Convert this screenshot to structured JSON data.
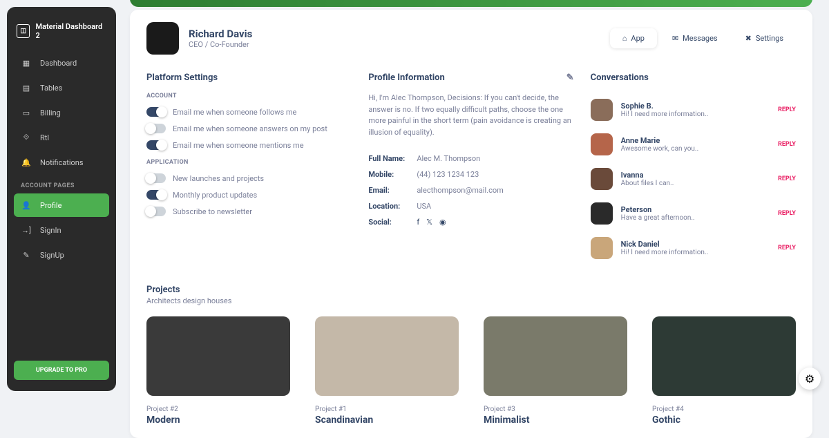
{
  "brand": "Material Dashboard 2",
  "nav": {
    "items": [
      "Dashboard",
      "Tables",
      "Billing",
      "Rtl",
      "Notifications"
    ],
    "section": "ACCOUNT PAGES",
    "account": [
      "Profile",
      "SignIn",
      "SignUp"
    ],
    "upgrade": "UPGRADE TO PRO"
  },
  "header": {
    "name": "Richard Davis",
    "role": "CEO / Co-Founder"
  },
  "tabs": {
    "app": "App",
    "messages": "Messages",
    "settings": "Settings"
  },
  "settings": {
    "title": "Platform Settings",
    "account_label": "ACCOUNT",
    "account": [
      {
        "label": "Email me when someone follows me",
        "on": true
      },
      {
        "label": "Email me when someone answers on my post",
        "on": false
      },
      {
        "label": "Email me when someone mentions me",
        "on": true
      }
    ],
    "app_label": "APPLICATION",
    "app": [
      {
        "label": "New launches and projects",
        "on": false
      },
      {
        "label": "Monthly product updates",
        "on": true
      },
      {
        "label": "Subscribe to newsletter",
        "on": false
      }
    ]
  },
  "profile": {
    "title": "Profile Information",
    "bio": "Hi, I'm Alec Thompson, Decisions: If you can't decide, the answer is no. If two equally difficult paths, choose the one more painful in the short term (pain avoidance is creating an illusion of equality).",
    "fullname_label": "Full Name:",
    "fullname": "Alec M. Thompson",
    "mobile_label": "Mobile:",
    "mobile": "(44) 123 1234 123",
    "email_label": "Email:",
    "email": "alecthompson@mail.com",
    "location_label": "Location:",
    "location": "USA",
    "social_label": "Social:"
  },
  "conversations": {
    "title": "Conversations",
    "reply": "REPLY",
    "items": [
      {
        "name": "Sophie B.",
        "msg": "Hi! I need more information.."
      },
      {
        "name": "Anne Marie",
        "msg": "Awesome work, can you.."
      },
      {
        "name": "Ivanna",
        "msg": "About files I can.."
      },
      {
        "name": "Peterson",
        "msg": "Have a great afternoon.."
      },
      {
        "name": "Nick Daniel",
        "msg": "Hi! I need more information.."
      }
    ]
  },
  "projects": {
    "title": "Projects",
    "sub": "Architects design houses",
    "items": [
      {
        "num": "Project #2",
        "name": "Modern"
      },
      {
        "num": "Project #1",
        "name": "Scandinavian"
      },
      {
        "num": "Project #3",
        "name": "Minimalist"
      },
      {
        "num": "Project #4",
        "name": "Gothic"
      }
    ]
  }
}
